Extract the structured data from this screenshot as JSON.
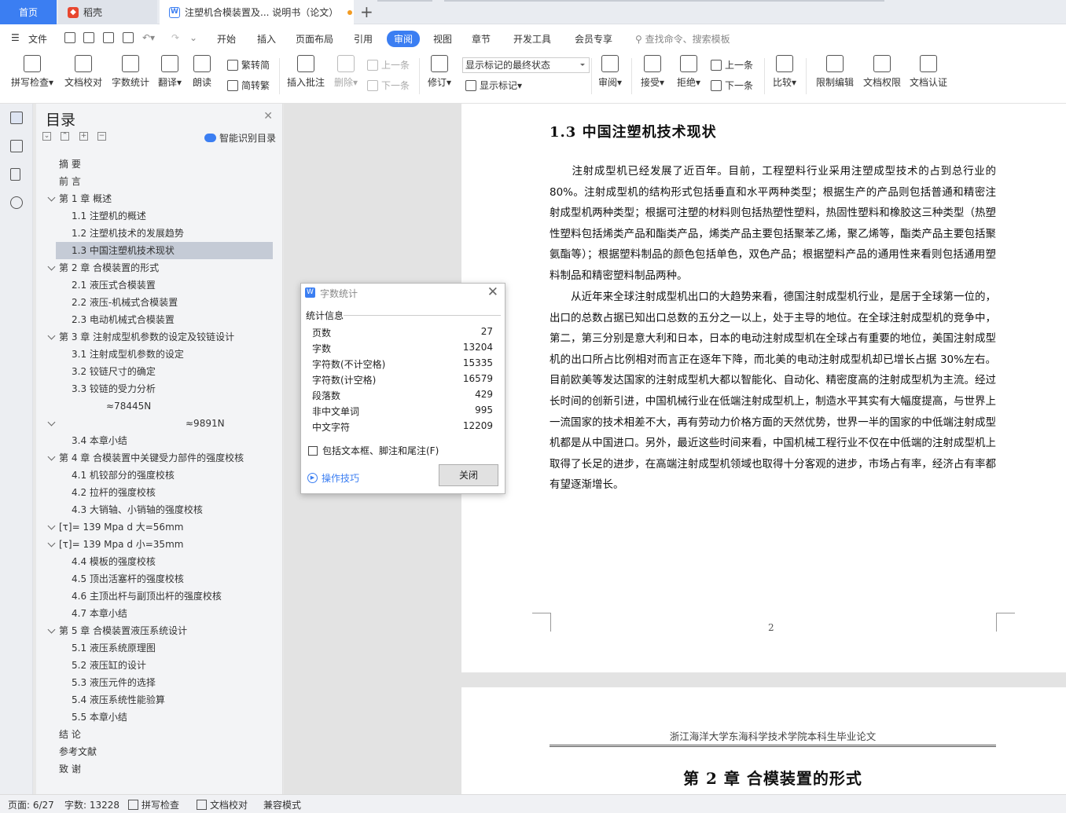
{
  "tabs": {
    "home": "首页",
    "daoke": "稻壳",
    "doc": "注塑机合模装置及... 说明书（论文）"
  },
  "menu": {
    "file": "文件",
    "items": [
      "开始",
      "插入",
      "页面布局",
      "引用",
      "审阅",
      "视图",
      "章节",
      "开发工具",
      "会员专享"
    ],
    "search_placeholder": "查找命令、搜索模板"
  },
  "ribbon": {
    "spellcheck": "拼写检查",
    "proofread": "文档校对",
    "wordcount": "字数统计",
    "translate": "翻译",
    "read": "朗读",
    "trad": "繁转简",
    "simp": "简转繁",
    "insert_comment": "插入批注",
    "delete": "删除",
    "prev": "上一条",
    "next": "下一条",
    "track": "修订",
    "markup_state": "显示标记的最终状态",
    "show_markup": "显示标记",
    "review": "审阅",
    "accept": "接受",
    "reject": "拒绝",
    "prev2": "上一条",
    "next2": "下一条",
    "compare": "比较",
    "restrict": "限制编辑",
    "permission": "文档权限",
    "certify": "文档认证"
  },
  "toc": {
    "title": "目录",
    "smart": "智能识别目录",
    "items": [
      {
        "text": "摘  要"
      },
      {
        "text": "前  言"
      },
      {
        "text": "第 1 章    概述"
      },
      {
        "text": "1.1  注塑机的概述"
      },
      {
        "text": "1.2    注塑机技术的发展趋势"
      },
      {
        "text": "1.3    中国注塑机技术现状"
      },
      {
        "text": "第 2 章    合模装置的形式"
      },
      {
        "text": "2.1    液压式合模装置"
      },
      {
        "text": "2.2    液压-机械式合模装置"
      },
      {
        "text": "2.3    电动机械式合模装置"
      },
      {
        "text": "第 3 章    注射成型机参数的设定及铰链设计"
      },
      {
        "text": "3.1    注射成型机参数的设定"
      },
      {
        "text": "3.2    铰链尺寸的确定"
      },
      {
        "text": "3.3    铰链的受力分析"
      },
      {
        "text": "≈78445N"
      },
      {
        "text": "≈9891N"
      },
      {
        "text": "3.4    本章小结"
      },
      {
        "text": "第 4 章    合模装置中关键受力部件的强度校核"
      },
      {
        "text": "4.1    机铰部分的强度校核"
      },
      {
        "text": "4.2    拉杆的强度校核"
      },
      {
        "text": "4.3    大销轴、小销轴的强度校核"
      },
      {
        "text": "[τ]= 139 Mpa        d 大=56mm"
      },
      {
        "text": "[τ]= 139 Mpa        d 小=35mm"
      },
      {
        "text": "4.4    模板的强度校核"
      },
      {
        "text": "4.5    顶出活塞杆的强度校核"
      },
      {
        "text": "4.6    主顶出杆与副顶出杆的强度校核"
      },
      {
        "text": "4.7    本章小结"
      },
      {
        "text": "第 5 章    合模装置液压系统设计"
      },
      {
        "text": "5.1    液压系统原理图"
      },
      {
        "text": "5.2    液压缸的设计"
      },
      {
        "text": "5.3    液压元件的选择"
      },
      {
        "text": "5.4    液压系统性能验算"
      },
      {
        "text": "5.5    本章小结"
      },
      {
        "text": "结    论"
      },
      {
        "text": "参考文献"
      },
      {
        "text": "致    谢"
      }
    ]
  },
  "document": {
    "section_title": "1.3   中国注塑机技术现状",
    "para1": "注射成型机已经发展了近百年。目前，工程塑料行业采用注塑成型技术的占到总行业的80%。注射成型机的结构形式包括垂直和水平两种类型；根据生产的产品则包括普通和精密注射成型机两种类型；根据可注塑的材料则包括热塑性塑料，热固性塑料和橡胶这三种类型（热塑性塑料包括烯类产品和酯类产品，烯类产品主要包括聚苯乙烯，聚乙烯等，酯类产品主要包括聚氨酯等）；根据塑料制品的颜色包括单色，双色产品；根据塑料产品的通用性来看则包括通用塑料制品和精密塑料制品两种。",
    "para2": "从近年来全球注射成型机出口的大趋势来看，德国注射成型机行业，是居于全球第一位的，出口的总数占据已知出口总数的五分之一以上，处于主导的地位。在全球注射成型机的竞争中，第二，第三分别是意大利和日本，日本的电动注射成型机在全球占有重要的地位，美国注射成型机的出口所占比例相对而言正在逐年下降，而北美的电动注射成型机却已增长占据 30%左右。目前欧美等发达国家的注射成型机大都以智能化、自动化、精密度高的注射成型机为主流。经过长时间的创新引进，中国机械行业在低端注射成型机上，制造水平其实有大幅度提高，与世界上一流国家的技术相差不大，再有劳动力价格方面的天然优势，世界一半的国家的中低端注射成型机都是从中国进口。另外，最近这些时间来看，中国机械工程行业不仅在中低端的注射成型机上取得了长足的进步，在高端注射成型机领域也取得十分客观的进步，市场占有率，经济占有率都有望逐渐增长。",
    "page_number": "2",
    "page2_header": "浙江海洋大学东海科学技术学院本科生毕业论文",
    "page2_chapter": "第 2 章    合模装置的形式"
  },
  "dialog": {
    "title": "字数统计",
    "section": "统计信息",
    "stats": [
      {
        "label": "页数",
        "value": "27"
      },
      {
        "label": "字数",
        "value": "13204"
      },
      {
        "label": "字符数(不计空格)",
        "value": "15335"
      },
      {
        "label": "字符数(计空格)",
        "value": "16579"
      },
      {
        "label": "段落数",
        "value": "429"
      },
      {
        "label": "非中文单词",
        "value": "995"
      },
      {
        "label": "中文字符",
        "value": "12209"
      }
    ],
    "include_label": "包括文本框、脚注和尾注(F)",
    "tips": "操作技巧",
    "close": "关闭"
  },
  "status": {
    "page": "页面: 6/27",
    "words": "字数: 13228",
    "spell": "拼写检查",
    "proof": "文档校对",
    "compat": "兼容模式"
  }
}
